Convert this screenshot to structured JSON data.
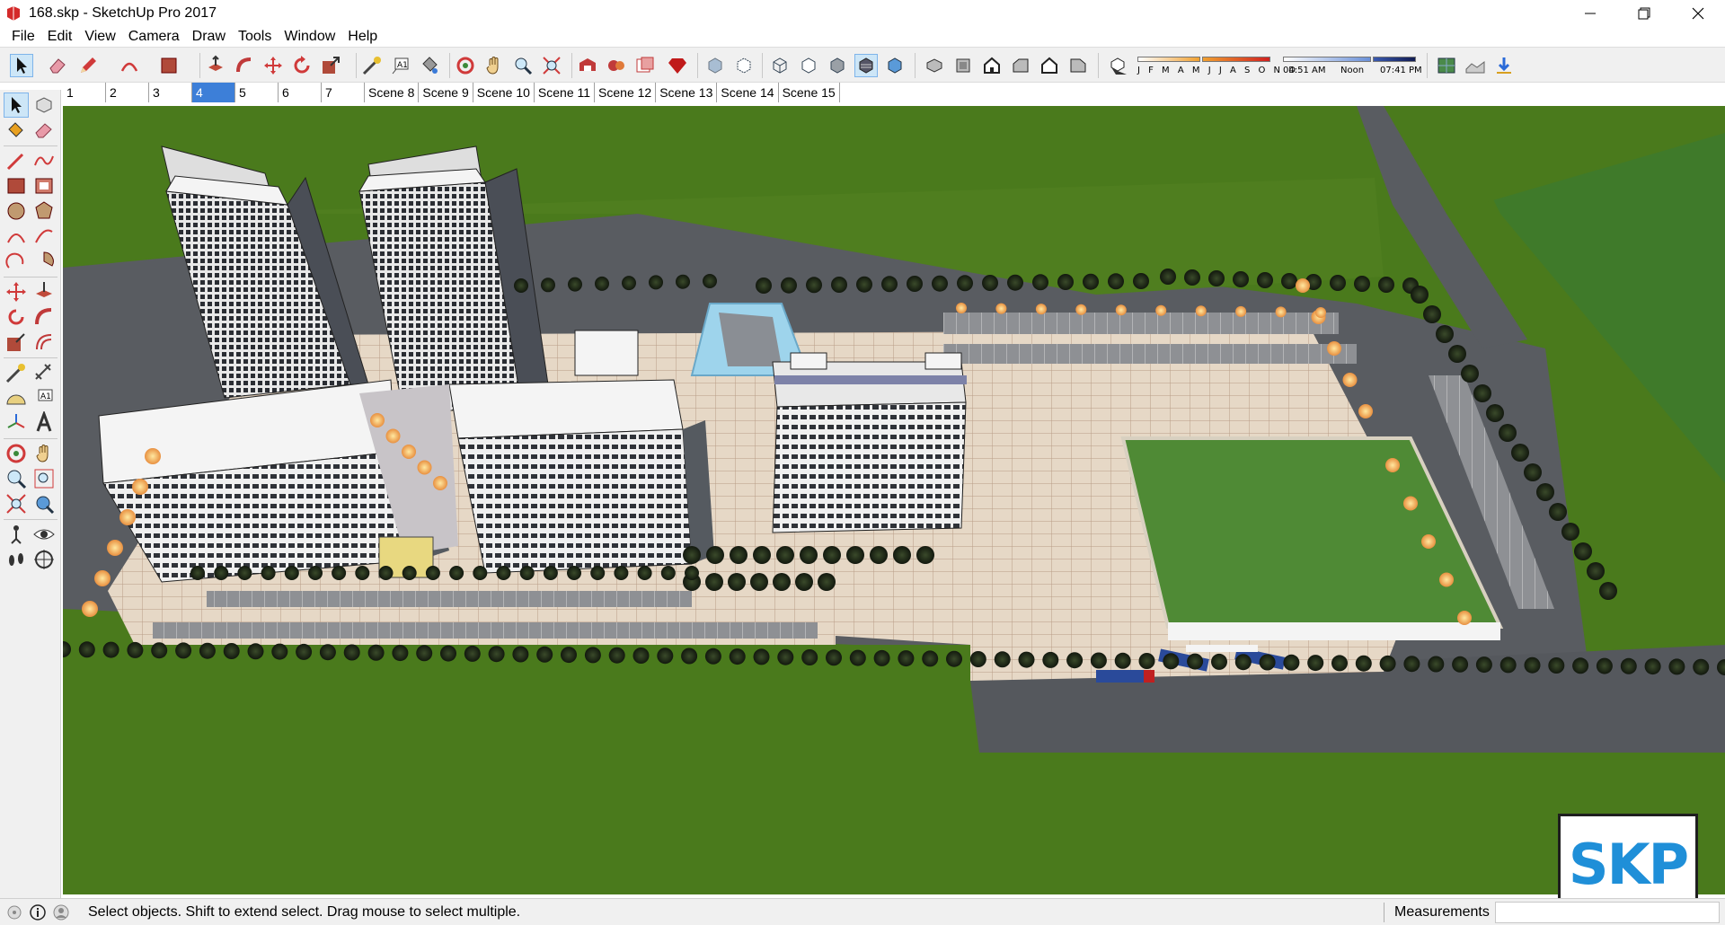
{
  "window": {
    "title": "168.skp - SketchUp Pro 2017",
    "icons": {
      "app": "sketchup-logo-icon",
      "minimize": "minimize-icon",
      "maximize": "restore-icon",
      "close": "close-icon"
    }
  },
  "menu": {
    "items": [
      "File",
      "Edit",
      "View",
      "Camera",
      "Draw",
      "Tools",
      "Window",
      "Help"
    ]
  },
  "toolbar": {
    "tools": [
      "select",
      "eraser",
      "pencil",
      "arc",
      "rectangle",
      "push-pull",
      "follow-me",
      "move",
      "rotate",
      "scale",
      "tape-measure",
      "text",
      "paint-bucket",
      "orbit",
      "pan",
      "zoom",
      "zoom-extents",
      "warehouse",
      "extension-warehouse",
      "send-to-layout",
      "ruby",
      "xray",
      "back-edges",
      "wireframe",
      "hidden-line",
      "shaded",
      "shaded-with-textures",
      "monochrome",
      "iso",
      "top",
      "front",
      "right",
      "back",
      "left",
      "shadows"
    ],
    "shadows": {
      "months_label": "J F M A M J J A S O N D",
      "time_start": "04:51 AM",
      "time_mid": "Noon",
      "time_end": "07:41 PM"
    }
  },
  "scenes": {
    "tabs": [
      "1",
      "2",
      "3",
      "4",
      "5",
      "6",
      "7",
      "Scene 8",
      "Scene 9",
      "Scene 10",
      "Scene 11",
      "Scene 12",
      "Scene 13",
      "Scene 14",
      "Scene 15"
    ],
    "active": "4"
  },
  "viewport": {
    "model_colors": {
      "grass": "#4a7a1c",
      "road": "#595c61",
      "pavement": "#e6d8c6",
      "lawn": "#4f8a35",
      "building": "#e8e8e8",
      "tree": "#1f2a18",
      "water": "#9ed4ec"
    }
  },
  "watermark": {
    "text": "SKP",
    "color": "#1f8fd8"
  },
  "statusbar": {
    "message": "Select objects. Shift to extend select. Drag mouse to select multiple.",
    "measurements_label": "Measurements",
    "measurements_value": ""
  }
}
